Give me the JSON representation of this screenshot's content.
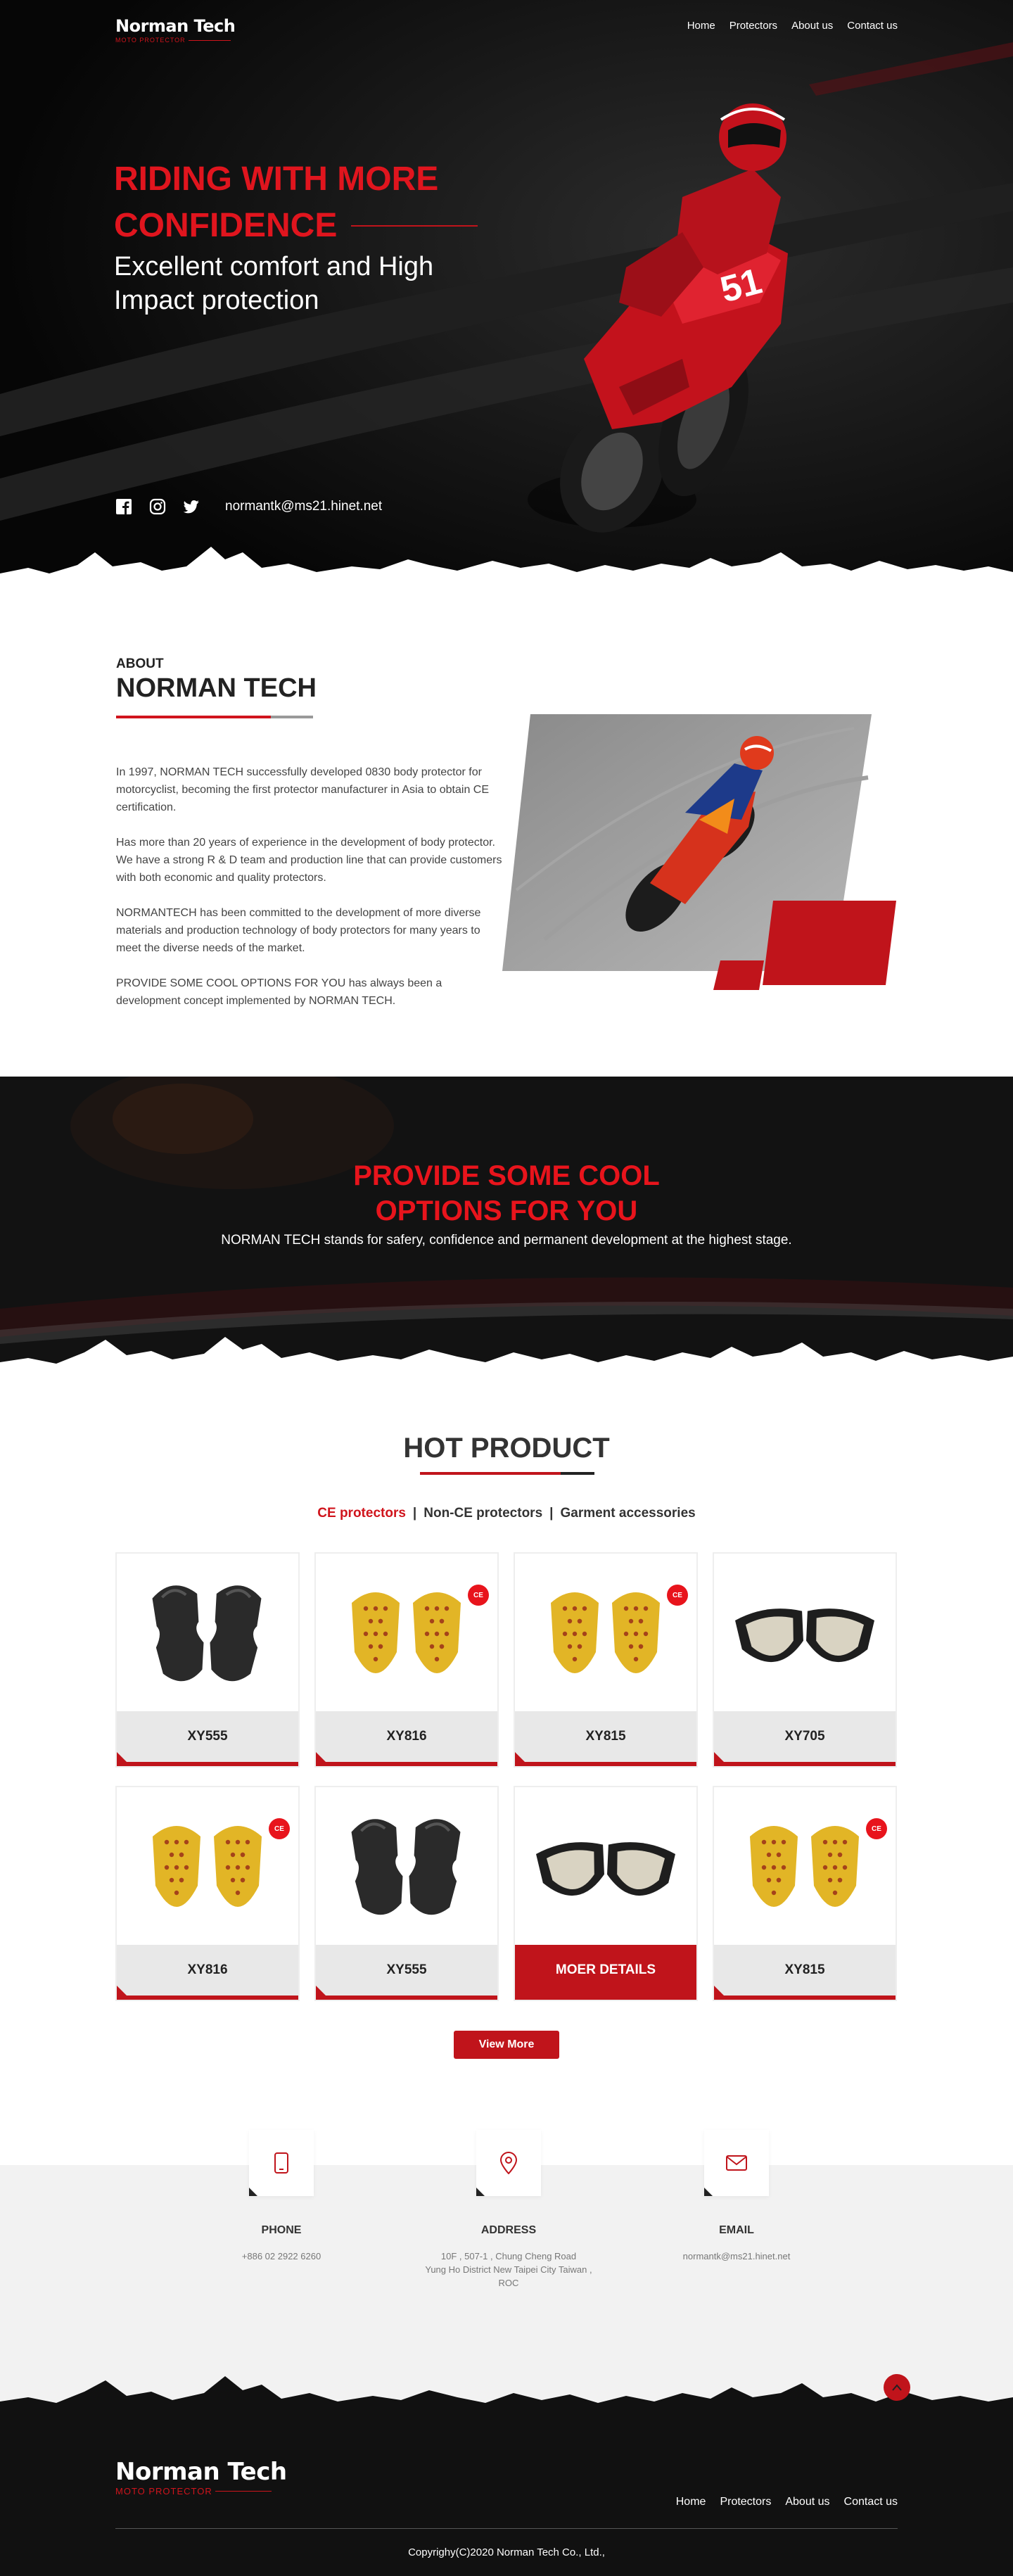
{
  "nav": {
    "logo_name": "Norman Tech",
    "logo_sub": "MOTO PROTECTOR",
    "links": [
      "Home",
      "Protectors",
      "About us",
      "Contact us"
    ]
  },
  "hero": {
    "title_line1": "RIDING WITH MORE",
    "title_line2": "CONFIDENCE",
    "subtitle": "Excellent comfort and High Impact protection",
    "email": "normantk@ms21.hinet.net",
    "social_icons": [
      "facebook-icon",
      "instagram-icon",
      "twitter-icon"
    ]
  },
  "about": {
    "eyebrow": "ABOUT",
    "title": "NORMAN TECH",
    "paragraphs": [
      "In 1997, NORMAN TECH successfully developed 0830 body protector for motorcyclist, becoming the first protector manufacturer in Asia to obtain CE certification.",
      "Has more than 20 years of experience in the development of body protector. We have a strong R & D team and production line that can provide customers with both economic and quality protectors.",
      "NORMANTECH has been committed to the development of more diverse materials and production technology of body protectors for many years to meet the diverse needs of the market.",
      "PROVIDE SOME COOL OPTIONS FOR YOU has always been a development concept implemented by NORMAN TECH."
    ]
  },
  "banner": {
    "heading_line1": "PROVIDE SOME COOL",
    "heading_line2": "OPTIONS FOR YOU",
    "subtitle": "NORMAN TECH stands for safery, confidence and permanent development at the highest stage."
  },
  "products": {
    "title": "HOT PRODUCT",
    "filters": [
      "CE protectors",
      "Non-CE protectors",
      "Garment accessories"
    ],
    "active_filter": 0,
    "items": [
      {
        "name": "XY555",
        "type": "black",
        "ce": false
      },
      {
        "name": "XY816",
        "type": "yellow",
        "ce": true
      },
      {
        "name": "XY815",
        "type": "yellow",
        "ce": true
      },
      {
        "name": "XY705",
        "type": "cup",
        "ce": false
      },
      {
        "name": "XY816",
        "type": "yellow",
        "ce": true
      },
      {
        "name": "XY555",
        "type": "black",
        "ce": false
      },
      {
        "name": "MOER DETAILS",
        "type": "cup",
        "ce": false
      },
      {
        "name": "XY815",
        "type": "yellow",
        "ce": true
      }
    ],
    "ce_badge": "CE",
    "view_more": "View More"
  },
  "contact": {
    "items": [
      {
        "heading": "PHONE",
        "lines": [
          "+886 02 2922 6260"
        ],
        "icon": "phone-icon"
      },
      {
        "heading": "ADDRESS",
        "lines": [
          "10F , 507-1 , Chung Cheng Road",
          "Yung Ho District New Taipei City Taiwan , ROC"
        ],
        "icon": "map-pin-icon"
      },
      {
        "heading": "EMAIL",
        "lines": [
          "normantk@ms21.hinet.net"
        ],
        "icon": "mail-icon"
      }
    ]
  },
  "footer": {
    "logo_name": "Norman Tech",
    "logo_sub": "MOTO PROTECTOR",
    "links": [
      "Home",
      "Protectors",
      "About us",
      "Contact us"
    ],
    "copyright": "Copyrighy(C)2020 Norman Tech Co., Ltd.,"
  },
  "colors": {
    "brand_red": "#d0141c",
    "dark": "#111111",
    "light_gray": "#f2f2f2"
  }
}
